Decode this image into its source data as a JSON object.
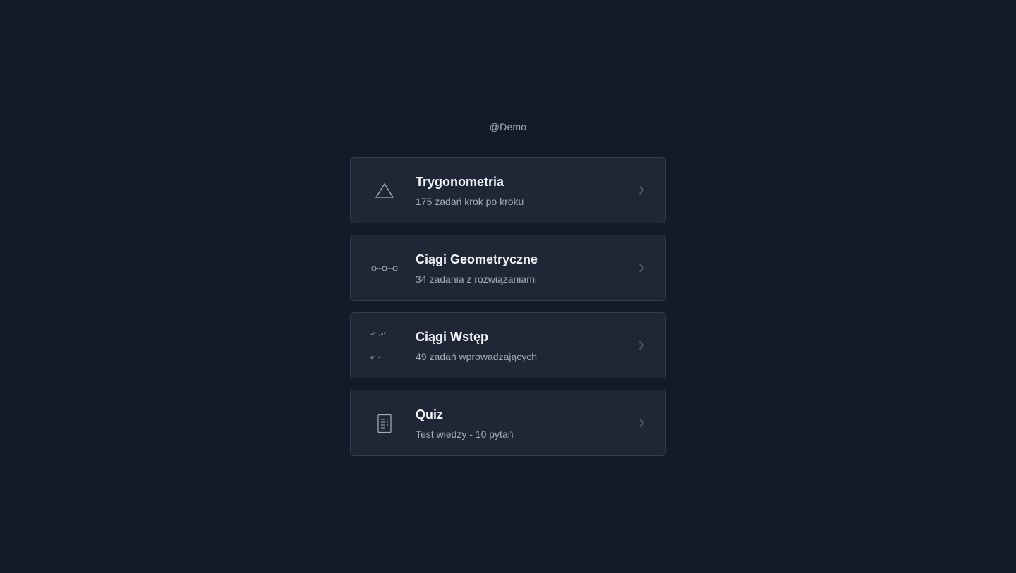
{
  "header": {
    "username": "@Demo"
  },
  "cards": [
    {
      "title": "Trygonometria",
      "subtitle": "175 zadań krok po kroku",
      "icon": "triangle-icon"
    },
    {
      "title": "Ciągi Geometryczne",
      "subtitle": "34 zadania z rozwiązaniami",
      "icon": "nodes-sequence-icon"
    },
    {
      "title": "Ciągi Wstęp",
      "subtitle": "49 zadań wprowadzających",
      "icon": "sequence-terms-icon",
      "icon_text_line1": "a¹ ,a² ,...",
      "icon_text_line2": "aⁿ ="
    },
    {
      "title": "Quiz",
      "subtitle": "Test wiedzy - 10 pytań",
      "icon": "quiz-sheet-icon"
    }
  ],
  "colors": {
    "background": "#131a29",
    "card_background": "#1f2737",
    "card_border": "#343d4d",
    "title_text": "#f1f3f6",
    "muted_text": "#a3abb8",
    "chevron": "#5b6474"
  }
}
